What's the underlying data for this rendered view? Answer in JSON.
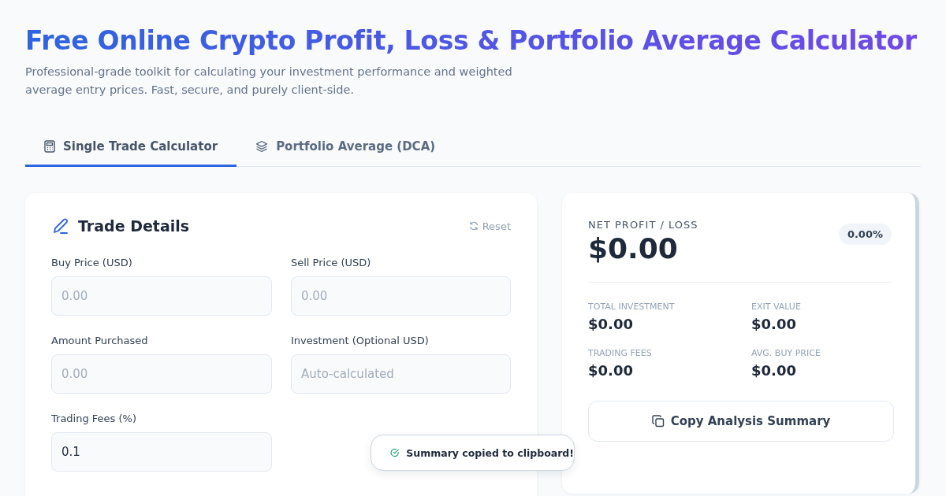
{
  "header": {
    "title": "Free Online Crypto Profit, Loss & Portfolio Average Calculator",
    "subtitle": "Professional-grade toolkit for calculating your investment performance and weighted average entry prices. Fast, secure, and purely client-side."
  },
  "tabs": [
    {
      "label": "Single Trade Calculator",
      "kind": "calculator",
      "selected": true
    },
    {
      "label": "Portfolio Average (DCA)",
      "kind": "layers",
      "selected": false
    }
  ],
  "trade_details": {
    "title": "Trade Details",
    "reset": "Reset",
    "fields": [
      {
        "label": "Buy Price (USD)",
        "placeholder": "0.00"
      },
      {
        "label": "Sell Price (USD)",
        "placeholder": "0.00"
      },
      {
        "label": "Amount Purchased",
        "placeholder": "0.00"
      },
      {
        "label": "Investment (Optional USD)",
        "placeholder": "Auto-calculated"
      },
      {
        "label": "Trading Fees (%)",
        "value": "0.1"
      }
    ]
  },
  "result": {
    "label": "NET PROFIT / LOSS",
    "value": "$0.00",
    "percent": "0.00%",
    "stats": [
      {
        "label": "TOTAL INVESTMENT",
        "value": "$0.00"
      },
      {
        "label": "EXIT VALUE",
        "value": "$0.00"
      },
      {
        "label": "TRADING FEES",
        "value": "$0.00"
      },
      {
        "label": "AVG. BUY PRICE",
        "value": "$0.00"
      }
    ],
    "copy_button": "Copy Analysis Summary"
  },
  "toast": {
    "message": "Summary copied to clipboard!"
  }
}
